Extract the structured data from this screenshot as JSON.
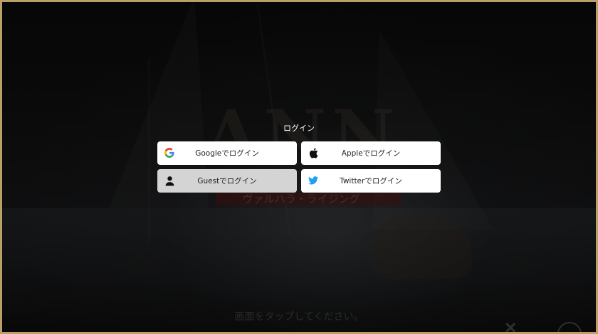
{
  "background": {
    "logo_text": "ANN",
    "subtitle": "ヴァルハラ・ライジング",
    "tap_prompt": "画面をタップしてください。"
  },
  "login": {
    "title": "ログイン",
    "buttons": [
      {
        "id": "google",
        "label": "Googleでログイン",
        "icon": "google-icon"
      },
      {
        "id": "apple",
        "label": "Appleでログイン",
        "icon": "apple-icon"
      },
      {
        "id": "guest",
        "label": "Guestでログイン",
        "icon": "user-icon"
      },
      {
        "id": "twitter",
        "label": "Twitterでログイン",
        "icon": "twitter-icon"
      }
    ]
  },
  "colors": {
    "frame_border": "#b9a067",
    "button_bg": "#ffffff",
    "guest_button_bg": "#d4d4d4",
    "twitter_blue": "#1da1f2"
  }
}
